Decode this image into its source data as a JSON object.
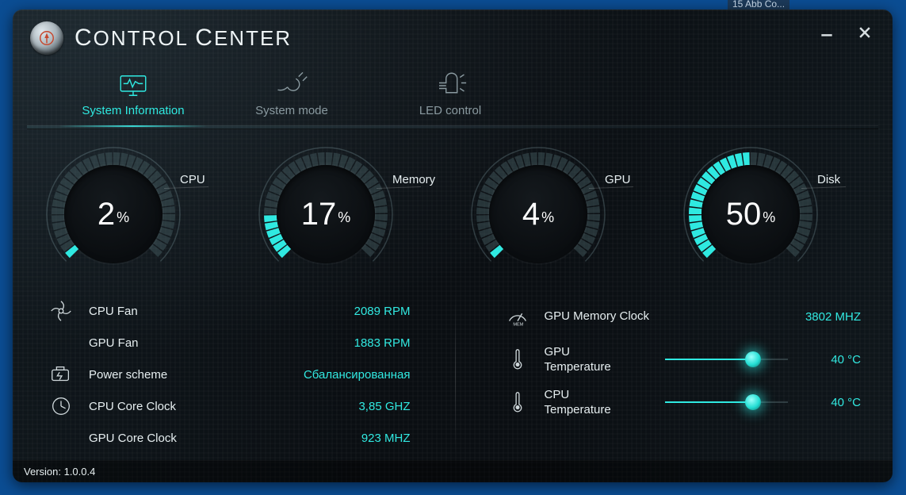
{
  "taskbar_hint": "15 Abb Co...",
  "app": {
    "title": "Control Center"
  },
  "window_controls": {
    "minimize": "minimize",
    "close": "close"
  },
  "tabs": [
    {
      "id": "system-information",
      "label": "System Information",
      "active": true
    },
    {
      "id": "system-mode",
      "label": "System mode",
      "active": false
    },
    {
      "id": "led-control",
      "label": "LED control",
      "active": false
    }
  ],
  "gauges": {
    "cpu": {
      "label": "CPU",
      "value": 2,
      "pct": "%"
    },
    "memory": {
      "label": "Memory",
      "value": 17,
      "pct": "%"
    },
    "gpu": {
      "label": "GPU",
      "value": 4,
      "pct": "%"
    },
    "disk": {
      "label": "Disk",
      "value": 50,
      "pct": "%"
    }
  },
  "left_rows": {
    "cpu_fan": {
      "label": "CPU Fan",
      "value": "2089 RPM"
    },
    "gpu_fan": {
      "label": "GPU Fan",
      "value": "1883 RPM"
    },
    "power": {
      "label": "Power scheme",
      "value": "Сбалансированная"
    },
    "cpu_clock": {
      "label": "CPU Core Clock",
      "value": "3,85 GHZ"
    },
    "gpu_clock": {
      "label": "GPU Core Clock",
      "value": "923 MHZ"
    }
  },
  "right_rows": {
    "gpu_mem_clock": {
      "label": "GPU Memory Clock",
      "value": "3802 MHZ"
    },
    "gpu_temp": {
      "label": "GPU\nTemperature",
      "value": "40 °C",
      "slider_pct": 72
    },
    "cpu_temp": {
      "label": "CPU\nTemperature",
      "value": "40 °C",
      "slider_pct": 72
    }
  },
  "footer": {
    "version_label": "Version: 1.0.0.4"
  }
}
